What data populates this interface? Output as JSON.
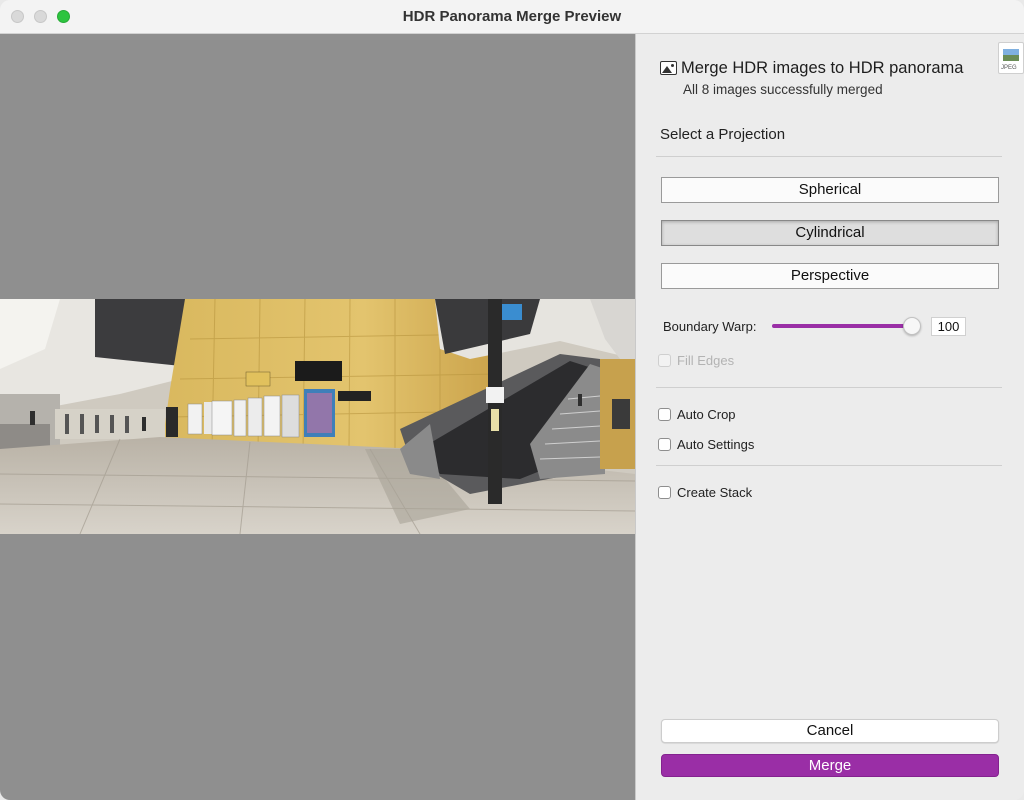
{
  "window": {
    "title": "HDR Panorama Merge Preview"
  },
  "panel": {
    "heading": "Merge HDR images to HDR panorama",
    "subheading": "All 8 images successfully merged",
    "projection_title": "Select a Projection",
    "projections": [
      {
        "label": "Spherical",
        "selected": false
      },
      {
        "label": "Cylindrical",
        "selected": true
      },
      {
        "label": "Perspective",
        "selected": false
      }
    ],
    "boundary_warp": {
      "label": "Boundary Warp:",
      "value": "100",
      "level_percent": 100,
      "accent_color": "#9a2fa6"
    },
    "checkboxes": {
      "fill_edges": {
        "label": "Fill Edges",
        "checked": false,
        "disabled": true
      },
      "auto_crop": {
        "label": "Auto Crop",
        "checked": false
      },
      "auto_settings": {
        "label": "Auto Settings",
        "checked": false
      },
      "create_stack": {
        "label": "Create Stack",
        "checked": false
      }
    },
    "cancel_label": "Cancel",
    "merge_label": "Merge",
    "merge_color": "#9a2ea6",
    "doc_badge_label": "JPEG"
  },
  "preview": {
    "background_color": "#8f8f8f"
  }
}
